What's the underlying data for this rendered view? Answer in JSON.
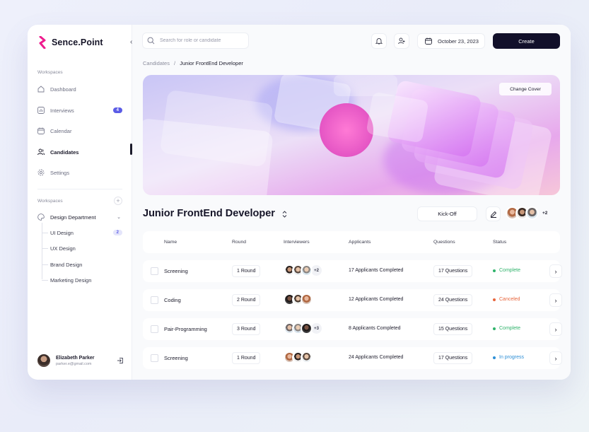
{
  "app": {
    "name": "Sence.Point",
    "brand_color": "#ee1c8e"
  },
  "sidebar": {
    "section_workspaces_1": "Workspaces",
    "items": [
      {
        "label": "Dashboard",
        "icon": "home-icon"
      },
      {
        "label": "Interviews",
        "icon": "chart-icon",
        "badge": "4"
      },
      {
        "label": "Calendar",
        "icon": "calendar-icon"
      },
      {
        "label": "Candidates",
        "icon": "users-icon",
        "active": true
      },
      {
        "label": "Settings",
        "icon": "gear-icon"
      }
    ],
    "section_workspaces_2": "Workspaces",
    "department": {
      "label": "Design Department",
      "icon": "palette-icon"
    },
    "sub_items": [
      {
        "label": "UI Design",
        "badge": "2"
      },
      {
        "label": "UX Design"
      },
      {
        "label": "Brand Design"
      },
      {
        "label": "Marketing Design"
      }
    ],
    "user": {
      "name": "Elizabeth Parker",
      "email": "parker.e@gmail.com"
    }
  },
  "header": {
    "search_placeholder": "Search for role or candidate",
    "date": "October 23, 2023",
    "create_label": "Create"
  },
  "breadcrumb": {
    "parent": "Candidates",
    "separator": "/",
    "current": "Junior FrontEnd Developer"
  },
  "cover": {
    "change_label": "Change Cover"
  },
  "job": {
    "title": "Junior FrontEnd Developer",
    "kickoff_label": "Kick-Off",
    "team_more": "+2"
  },
  "table": {
    "columns": [
      "Name",
      "Round",
      "Interviewers",
      "Applicants",
      "Questions",
      "Status"
    ],
    "rows": [
      {
        "name": "Screening",
        "round": "1 Round",
        "interviewers_more": "+2",
        "applicants": "17 Applicants Completed",
        "questions": "17 Questions",
        "status": "Complete",
        "status_color": "#2fb36b"
      },
      {
        "name": "Coding",
        "round": "2 Round",
        "interviewers_more": "",
        "applicants": "12 Applicants Completed",
        "questions": "24 Questions",
        "status": "Canceled",
        "status_color": "#e8663d"
      },
      {
        "name": "Pair-Programming",
        "round": "3 Round",
        "interviewers_more": "+3",
        "applicants": "8 Applicants Completed",
        "questions": "15 Questions",
        "status": "Complete",
        "status_color": "#2fb36b"
      },
      {
        "name": "Screening",
        "round": "1 Round",
        "interviewers_more": "",
        "applicants": "24 Applicants Completed",
        "questions": "17 Questions",
        "status": "In progress",
        "status_color": "#2e8fd6"
      }
    ]
  }
}
